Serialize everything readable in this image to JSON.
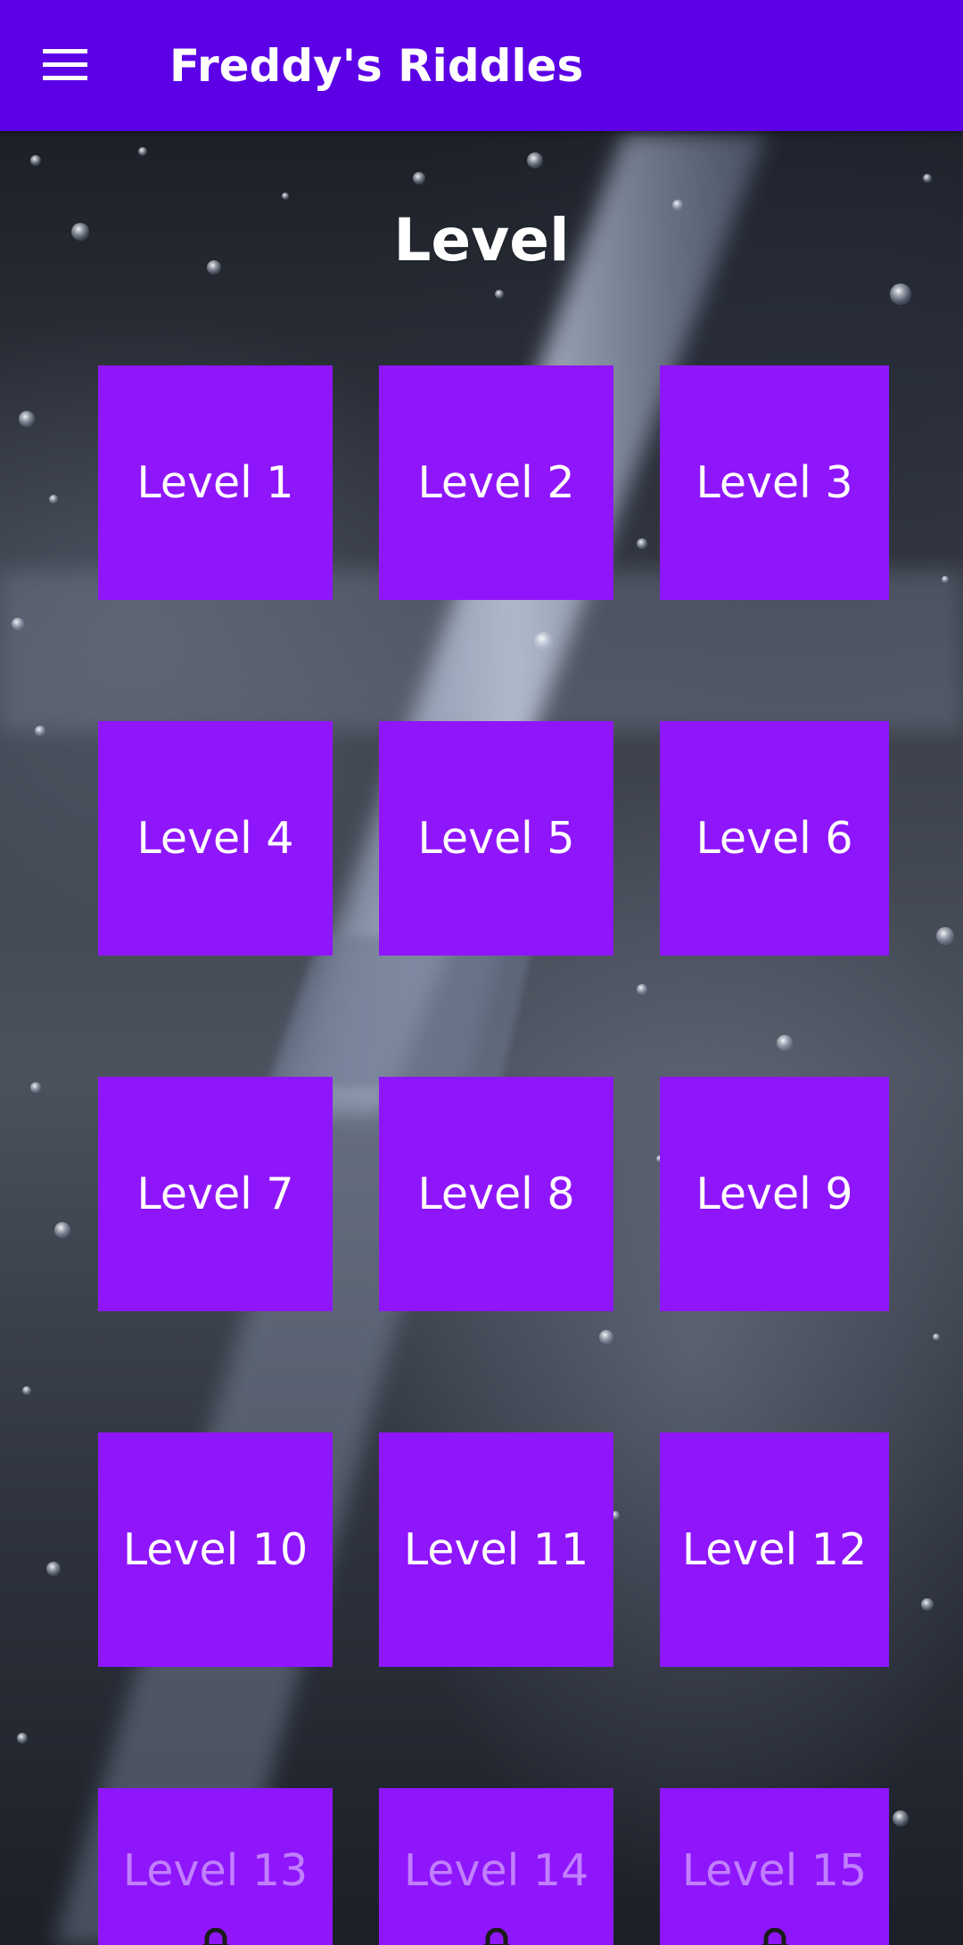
{
  "app_bar": {
    "title": "Freddy's Riddles",
    "menu_icon": "hamburger-menu-icon"
  },
  "page": {
    "heading": "Level"
  },
  "levels": [
    {
      "label": "Level 1",
      "locked": false
    },
    {
      "label": "Level 2",
      "locked": false
    },
    {
      "label": "Level 3",
      "locked": false
    },
    {
      "label": "Level 4",
      "locked": false
    },
    {
      "label": "Level 5",
      "locked": false
    },
    {
      "label": "Level 6",
      "locked": false
    },
    {
      "label": "Level 7",
      "locked": false
    },
    {
      "label": "Level 8",
      "locked": false
    },
    {
      "label": "Level 9",
      "locked": false
    },
    {
      "label": "Level 10",
      "locked": false
    },
    {
      "label": "Level 11",
      "locked": false
    },
    {
      "label": "Level 12",
      "locked": false
    },
    {
      "label": "Level 13",
      "locked": true,
      "icon": "lock-icon"
    },
    {
      "label": "Level 14",
      "locked": true,
      "icon": "lock-icon"
    },
    {
      "label": "Level 15",
      "locked": true,
      "icon": "lock-icon"
    }
  ],
  "colors": {
    "app_bar": "#5c00e6",
    "tile": "#8f16fb",
    "text": "#ffffff"
  }
}
